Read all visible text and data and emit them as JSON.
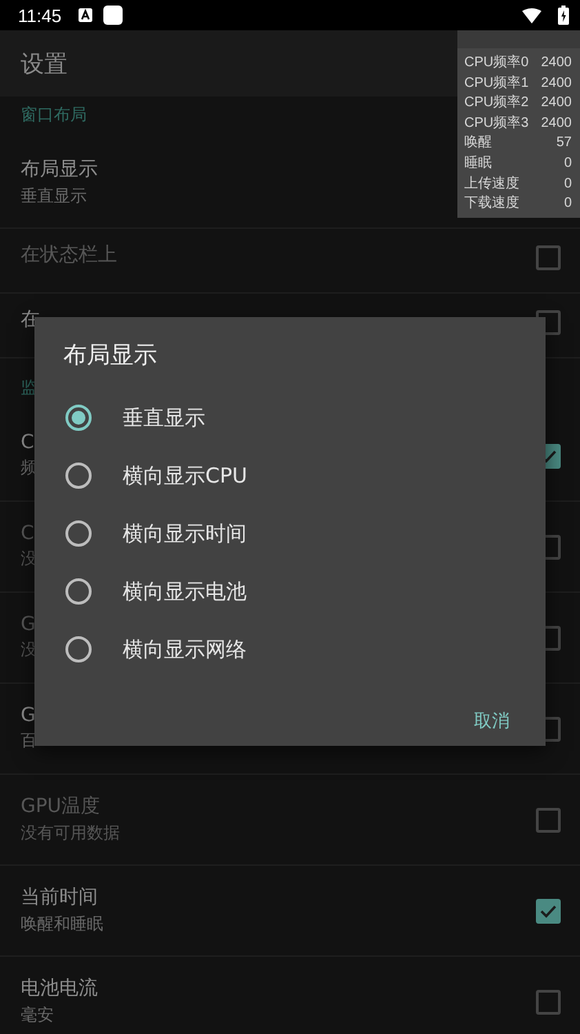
{
  "status_bar": {
    "time": "11:45"
  },
  "app_bar": {
    "title": "设置"
  },
  "overlay_stats": [
    {
      "label": "CPU频率0",
      "value": "2400"
    },
    {
      "label": "CPU频率1",
      "value": "2400"
    },
    {
      "label": "CPU频率2",
      "value": "2400"
    },
    {
      "label": "CPU频率3",
      "value": "2400"
    },
    {
      "label": "唤醒",
      "value": "57"
    },
    {
      "label": "睡眠",
      "value": "0"
    },
    {
      "label": "上传速度",
      "value": "0"
    },
    {
      "label": "下载速度",
      "value": "0"
    }
  ],
  "settings": [
    {
      "kind": "header",
      "title": "窗口布局"
    },
    {
      "kind": "value",
      "title": "布局显示",
      "subtitle": "垂直显示",
      "disabled": false
    },
    {
      "kind": "checkbox",
      "title": "在状态栏上",
      "disabled": true,
      "checked": false
    },
    {
      "kind": "checkbox",
      "title": "在",
      "disabled": false,
      "checked": false
    },
    {
      "kind": "header",
      "title": "监"
    },
    {
      "kind": "checkbox",
      "title": "C",
      "subtitle": "频",
      "disabled": false,
      "checked": true
    },
    {
      "kind": "checkbox",
      "title": "C",
      "subtitle": "没",
      "disabled": true,
      "checked": false
    },
    {
      "kind": "checkbox",
      "title": "G",
      "subtitle": "没",
      "disabled": true,
      "checked": false
    },
    {
      "kind": "checkbox",
      "title": "G",
      "subtitle": "百",
      "disabled": false,
      "checked": false
    },
    {
      "kind": "checkbox",
      "title": "GPU温度",
      "subtitle": "没有可用数据",
      "disabled": true,
      "checked": false
    },
    {
      "kind": "checkbox",
      "title": "当前时间",
      "subtitle": "唤醒和睡眠",
      "disabled": false,
      "checked": true
    },
    {
      "kind": "checkbox",
      "title": "电池电流",
      "subtitle": "毫安",
      "disabled": false,
      "checked": false
    }
  ],
  "dialog": {
    "title": "布局显示",
    "options": [
      {
        "label": "垂直显示",
        "selected": true
      },
      {
        "label": "横向显示CPU",
        "selected": false
      },
      {
        "label": "横向显示时间",
        "selected": false
      },
      {
        "label": "横向显示电池",
        "selected": false
      },
      {
        "label": "横向显示网络",
        "selected": false
      }
    ],
    "buttons": [
      "取消"
    ]
  }
}
